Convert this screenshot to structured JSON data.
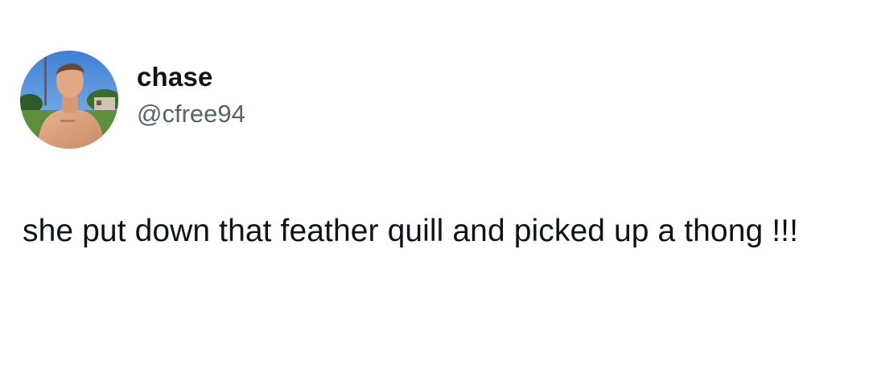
{
  "tweet": {
    "author": {
      "display_name": "chase",
      "handle": "@cfree94",
      "avatar_icon": "profile-photo-shirtless-man-outdoors"
    },
    "text": "she put down that feather quill and picked up a thong !!!"
  },
  "colors": {
    "text_primary": "#0f1419",
    "text_secondary": "#536471",
    "background": "#ffffff"
  }
}
